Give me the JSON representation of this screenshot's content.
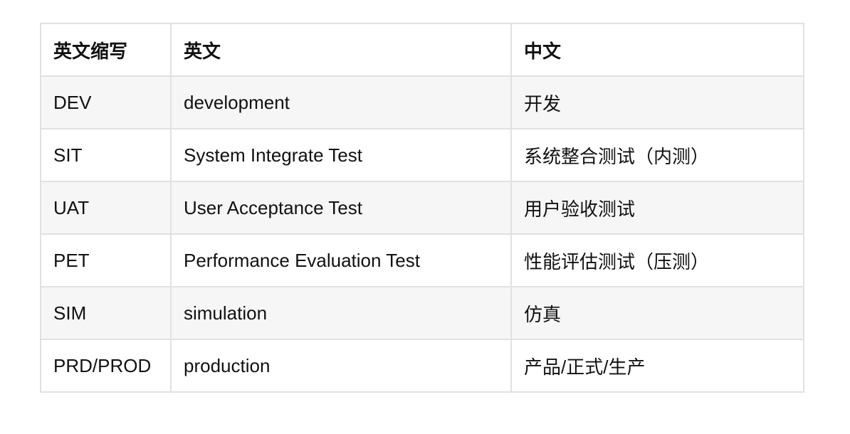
{
  "table": {
    "headers": [
      "英文缩写",
      "英文",
      "中文"
    ],
    "rows": [
      [
        "DEV",
        "development",
        "开发"
      ],
      [
        "SIT",
        "System Integrate Test",
        "系统整合测试（内测）"
      ],
      [
        "UAT",
        "User Acceptance Test",
        "用户验收测试"
      ],
      [
        "PET",
        "Performance Evaluation Test",
        "性能评估测试（压测）"
      ],
      [
        "SIM",
        "simulation",
        "仿真"
      ],
      [
        "PRD/PROD",
        "production",
        "产品/正式/生产"
      ]
    ]
  }
}
